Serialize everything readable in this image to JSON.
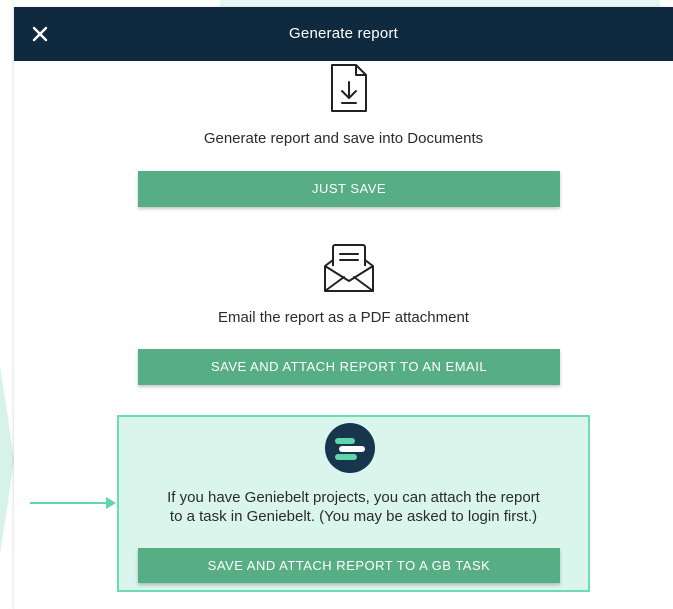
{
  "dialog": {
    "title": "Generate report",
    "close_icon": "close-icon"
  },
  "save_option": {
    "icon": "document-download-icon",
    "description": "Generate report and save into Documents",
    "button_label": "JUST SAVE"
  },
  "email_option": {
    "icon": "envelope-open-icon",
    "description": "Email the report as a PDF attachment",
    "button_label": "SAVE AND ATTACH REPORT TO AN EMAIL"
  },
  "geniebelt_option": {
    "icon": "geniebelt-logo-icon",
    "description_line1": "If you have Geniebelt projects, you can attach the report",
    "description_line2": "to a task in Geniebelt. (You may be asked to login first.)",
    "button_label": "SAVE AND ATTACH REPORT TO A GB TASK"
  },
  "annotation": {
    "icon": "arrow-right-icon"
  },
  "colors": {
    "header_bg": "#0f2a3f",
    "button_bg": "#57ad84",
    "highlight_bg": "#d9f5ec",
    "highlight_border": "#6fdbb5",
    "logo_bg": "#17364d"
  }
}
